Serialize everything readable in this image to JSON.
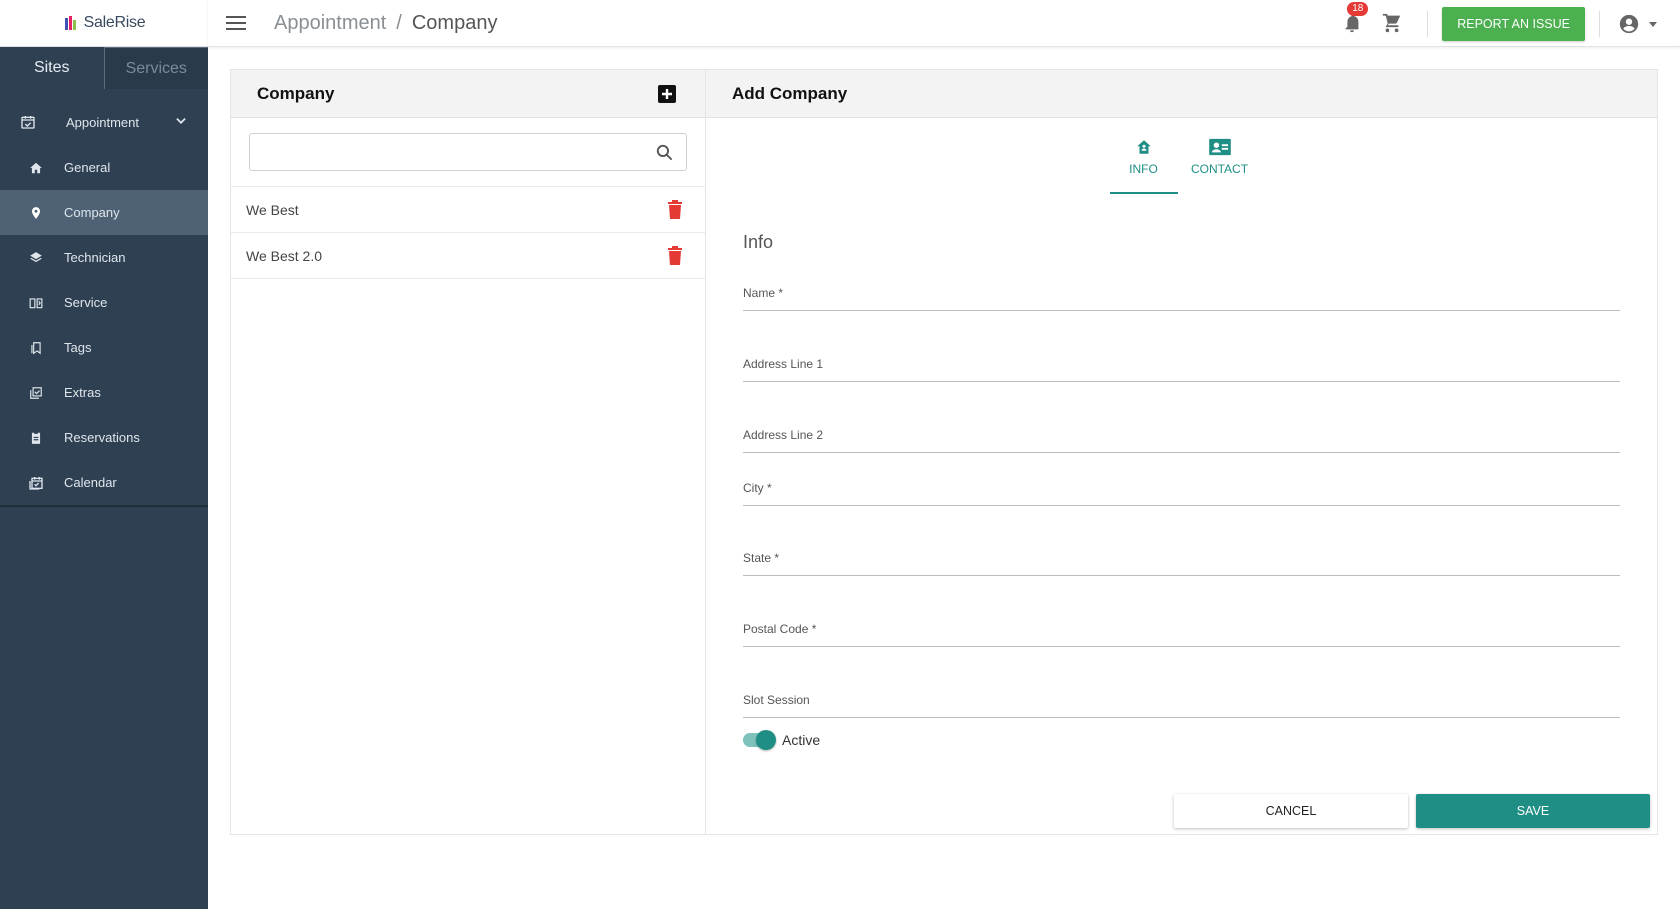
{
  "app": {
    "logo_text": "SaleRise"
  },
  "sidebar": {
    "tabs": [
      {
        "label": "Sites"
      },
      {
        "label": "Services"
      }
    ],
    "group": {
      "label": "Appointment"
    },
    "items": [
      {
        "label": "General"
      },
      {
        "label": "Company"
      },
      {
        "label": "Technician"
      },
      {
        "label": "Service"
      },
      {
        "label": "Tags"
      },
      {
        "label": "Extras"
      },
      {
        "label": "Reservations"
      },
      {
        "label": "Calendar"
      }
    ]
  },
  "header": {
    "breadcrumb": [
      "Appointment",
      "Company"
    ],
    "separator": "/",
    "notification_count": "18",
    "report_label": "REPORT AN ISSUE"
  },
  "list_panel": {
    "title": "Company",
    "search": {
      "value": "",
      "placeholder": ""
    },
    "items": [
      {
        "name": "We Best"
      },
      {
        "name": "We Best 2.0"
      }
    ]
  },
  "form_panel": {
    "title": "Add Company",
    "tabs": [
      {
        "label": "INFO"
      },
      {
        "label": "CONTACT"
      }
    ],
    "section_title": "Info",
    "fields": [
      {
        "label": "Name *",
        "value": ""
      },
      {
        "label": "Address Line 1",
        "value": ""
      },
      {
        "label": "Address Line 2",
        "value": ""
      },
      {
        "label": "City *",
        "value": ""
      },
      {
        "label": "State *",
        "value": ""
      },
      {
        "label": "Postal Code *",
        "value": ""
      },
      {
        "label": "Slot Session",
        "value": ""
      }
    ],
    "active_label": "Active",
    "cancel_label": "CANCEL",
    "save_label": "SAVE"
  },
  "colors": {
    "accent": "#1f8f86",
    "sidebar": "#2f4052",
    "report": "#4caf50",
    "danger": "#e53935"
  }
}
